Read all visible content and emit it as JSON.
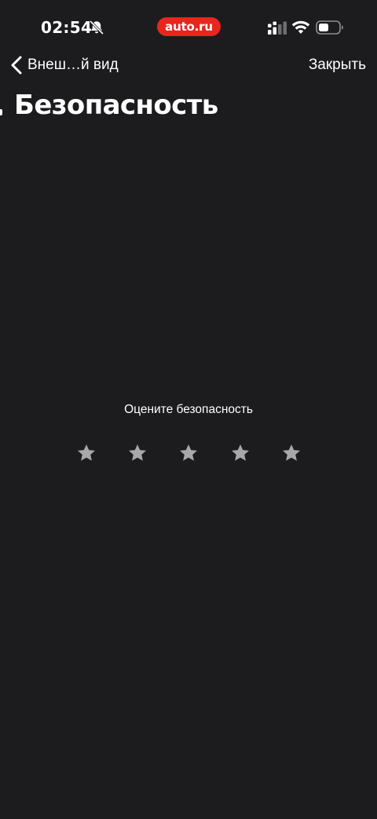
{
  "status_bar": {
    "time": "02:54",
    "brand": "auto.ru",
    "brand_color": "#e8261c",
    "icons": [
      "bell-slash-icon",
      "cellular-signal-icon",
      "wifi-icon",
      "battery-icon"
    ]
  },
  "nav": {
    "back_label": "Внеш…й вид",
    "close_label": "Закрыть"
  },
  "page": {
    "title": "Безопасность"
  },
  "rating": {
    "prompt": "Оцените безопасность",
    "max": 5,
    "value": 0,
    "star_color": "#a8a8ab"
  },
  "colors": {
    "background": "#1c1c1e",
    "text": "#ffffff"
  }
}
